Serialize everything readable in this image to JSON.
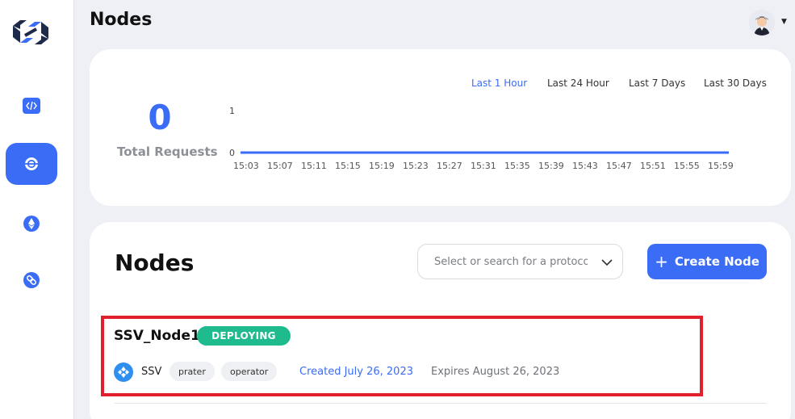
{
  "header": {
    "title": "Nodes"
  },
  "sidebar": {
    "items": [
      {
        "icon": "code-icon",
        "active": false
      },
      {
        "icon": "node-icon",
        "active": true
      },
      {
        "icon": "ethereum-icon",
        "active": false
      },
      {
        "icon": "link-icon",
        "active": false
      }
    ]
  },
  "stats": {
    "total_requests_value": "0",
    "total_requests_label": "Total Requests",
    "range_tabs": [
      "Last 1 Hour",
      "Last 24 Hour",
      "Last 7 Days",
      "Last 30 Days"
    ],
    "active_range": "Last 1 Hour"
  },
  "chart_data": {
    "type": "line",
    "x": [
      "15:03",
      "15:07",
      "15:11",
      "15:15",
      "15:19",
      "15:23",
      "15:27",
      "15:31",
      "15:35",
      "15:39",
      "15:43",
      "15:47",
      "15:51",
      "15:55",
      "15:59"
    ],
    "series": [
      {
        "values": [
          0,
          0,
          0,
          0,
          0,
          0,
          0,
          0,
          0,
          0,
          0,
          0,
          0,
          0,
          0
        ]
      }
    ],
    "y_ticks": [
      "1",
      "0"
    ],
    "ylim": [
      0,
      1
    ],
    "grid": false,
    "line_color": "#3b6cf6"
  },
  "nodes_panel": {
    "title": "Nodes",
    "search_placeholder": "Select or search for a protocol",
    "create_label": "Create Node"
  },
  "nodes": [
    {
      "name": "SSV_Node1",
      "status": "DEPLOYING",
      "protocol": "SSV",
      "tags": [
        "prater",
        "operator"
      ],
      "created": "Created July 26, 2023",
      "expires": "Expires August 26, 2023"
    }
  ],
  "colors": {
    "accent": "#3b6cf6",
    "status_deploying": "#1fba8e",
    "highlight": "#e1202e"
  }
}
